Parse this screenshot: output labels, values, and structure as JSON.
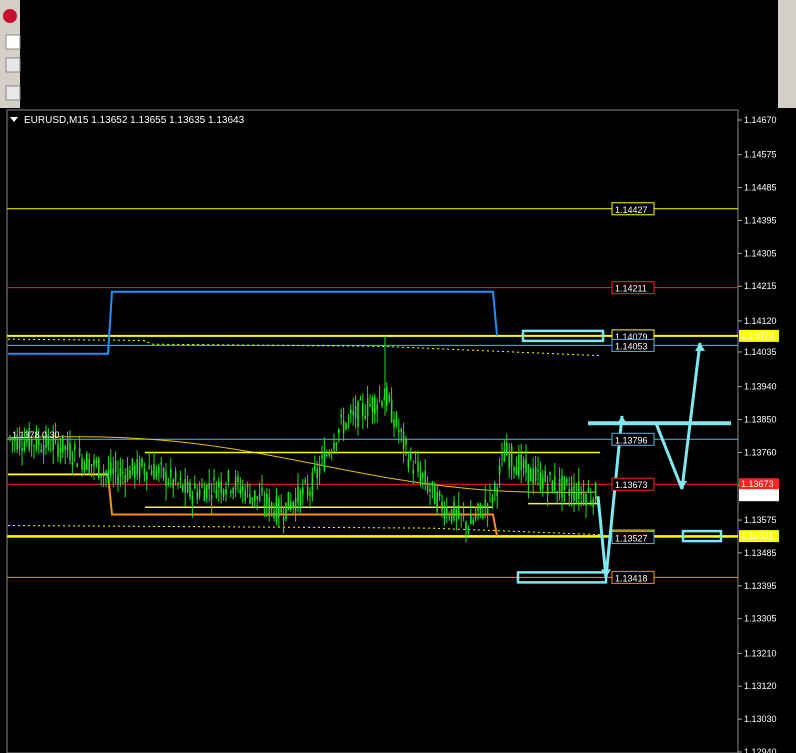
{
  "chart_data": {
    "type": "line",
    "symbol": "EURUSD,M15",
    "ohlc": [
      "1.13652",
      "1.13655",
      "1.13635",
      "1.13643"
    ],
    "indicator_label": "1.1378 0.30",
    "y_ticks": [
      "1.14670",
      "1.14575",
      "1.14485",
      "1.14395",
      "1.14305",
      "1.14215",
      "1.14120",
      "1.14035",
      "1.13940",
      "1.13850",
      "1.13760",
      "1.13670",
      "1.13575",
      "1.13485",
      "1.13395",
      "1.13305",
      "1.13210",
      "1.13120",
      "1.13030",
      "1.12940"
    ],
    "ylim": [
      1.1294,
      1.1467
    ],
    "current_price": "1.13643",
    "levels": [
      {
        "label": "1.14427",
        "color": "#ffff00",
        "type": "horizontal"
      },
      {
        "label": "1.14211",
        "color": "#ff2222",
        "type": "horizontal"
      },
      {
        "label": "1.14079",
        "color": "#ffff00",
        "type": "horizontal"
      },
      {
        "label": "1.14053",
        "color": "#5ab4e6",
        "type": "horizontal"
      },
      {
        "label": "1.13796",
        "color": "#5ab4e6",
        "type": "horizontal"
      },
      {
        "label": "1.13673",
        "color": "#ff2222",
        "type": "horizontal"
      },
      {
        "label": "1.13531",
        "color": "#ffff00",
        "type": "horizontal"
      },
      {
        "label": "1.13527",
        "color": "#5ab4e6",
        "type": "horizontal"
      },
      {
        "label": "1.13418",
        "color": "#ff8c1a",
        "type": "horizontal"
      }
    ],
    "colors": {
      "background": "#000000",
      "candles": "#22dd22",
      "yellow": "#ffff00",
      "cyan": "#7fe8f0",
      "blue": "#1e90ff",
      "red": "#ff2222",
      "orange": "#ff8c1a"
    }
  }
}
